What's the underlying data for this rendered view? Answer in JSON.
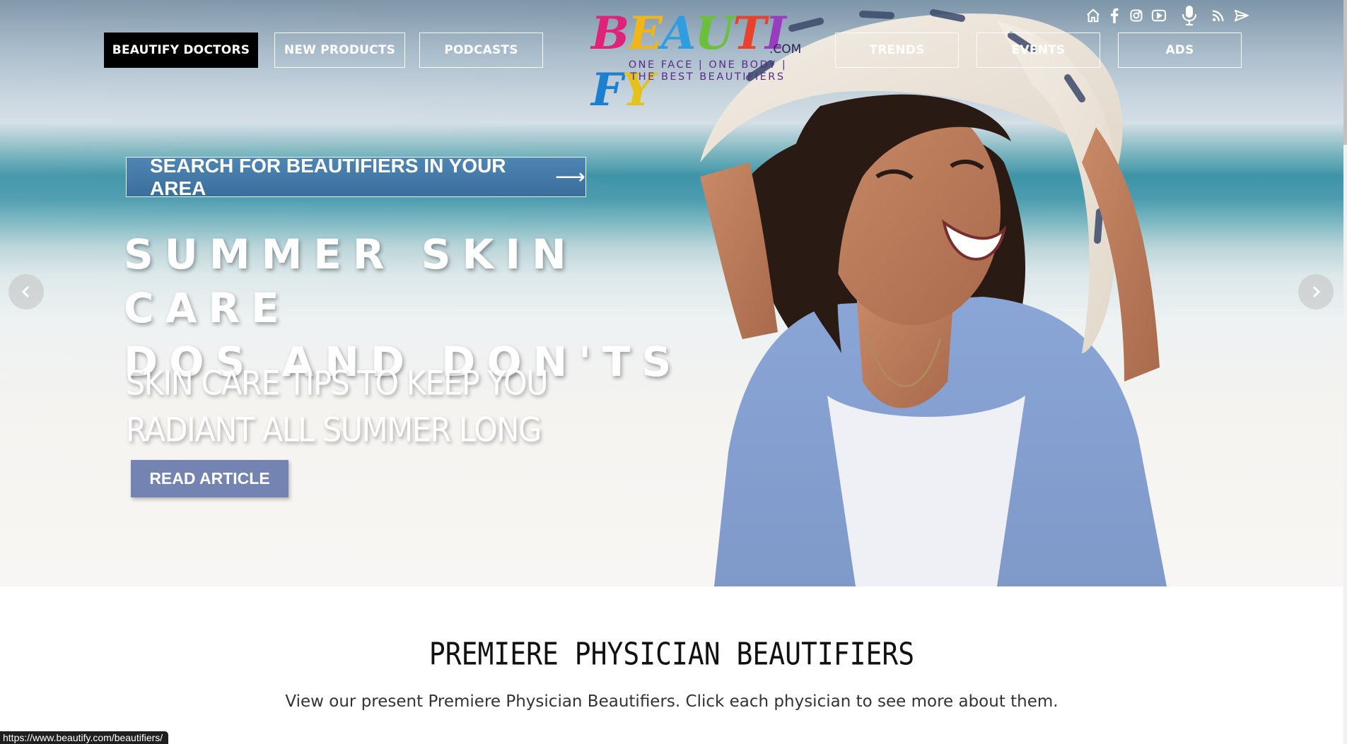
{
  "nav": {
    "left": [
      {
        "label": "BEAUTIFY DOCTORS",
        "active": true
      },
      {
        "label": "NEW PRODUCTS"
      },
      {
        "label": "PODCASTS"
      }
    ],
    "right": [
      {
        "label": "TRENDS"
      },
      {
        "label": "EVENTS"
      },
      {
        "label": "ADS"
      }
    ]
  },
  "logo": {
    "word": "BEAUTIFY",
    "suffix": ".COM",
    "tagline_1": "ONE FACE | ONE BODY |",
    "tagline_2": "THE BEST BEAUTIFIERS"
  },
  "social_icons": [
    "home-icon",
    "facebook-icon",
    "instagram-icon",
    "youtube-icon",
    "microphone-icon",
    "rss-icon",
    "send-icon"
  ],
  "hero": {
    "search_label": "SEARCH FOR BEAUTIFIERS IN YOUR AREA",
    "search_arrow": "⟶",
    "headline_1": "SUMMER SKIN CARE",
    "headline_2": "DOS AND DON'TS",
    "subhead_1": "SKIN CARE TIPS TO KEEP YOU",
    "subhead_2": "RADIANT ALL SUMMER LONG",
    "cta": "READ ARTICLE"
  },
  "section": {
    "title": "PREMIERE PHYSICIAN BEAUTIFIERS",
    "description": "View our present Premiere Physician Beautifiers. Click each physician to see more about them."
  },
  "status_bar": {
    "url": "https://www.beautify.com/beautifiers/"
  },
  "colors": {
    "search_button": "#4577a5",
    "read_button": "#7383b2",
    "logo_tagline": "#5a2b87"
  }
}
